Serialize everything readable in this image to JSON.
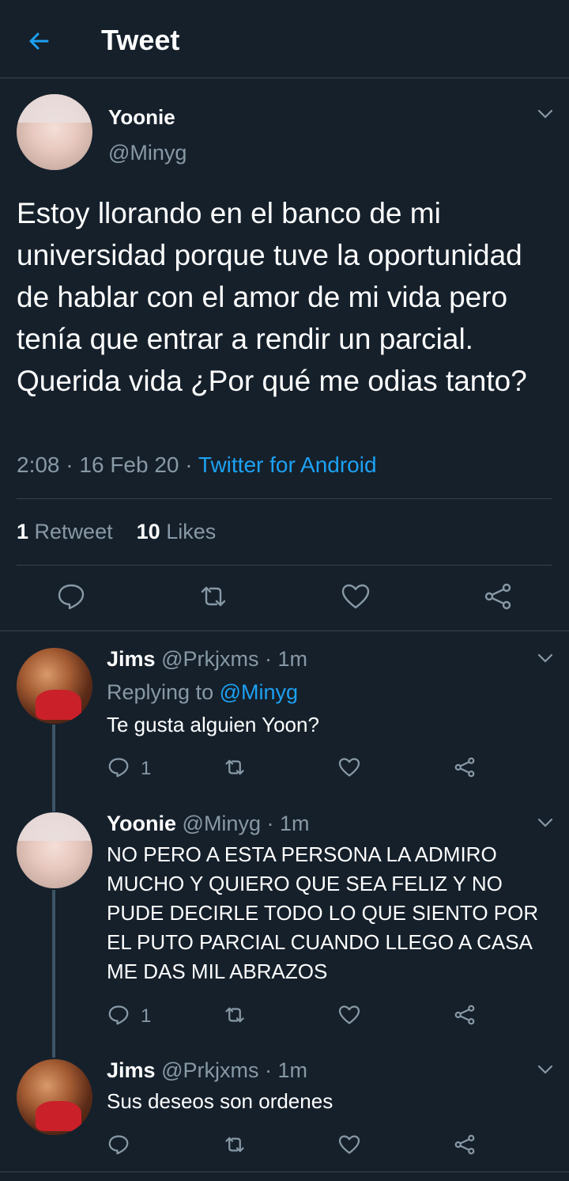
{
  "header": {
    "title": "Tweet"
  },
  "main_tweet": {
    "name": "Yoonie",
    "handle": "@Minyg",
    "text": "Estoy llorando en el banco de mi universidad porque tuve la oportunidad de hablar con el amor de mi vida pero tenía que entrar a rendir un parcial. Querida vida ¿Por qué me odias tanto?",
    "time": "2:08",
    "date": "16 Feb 20",
    "source": "Twitter for Android",
    "retweets": "1",
    "retweets_label": "Retweet",
    "likes": "10",
    "likes_label": "Likes"
  },
  "replies": [
    {
      "name": "Jims",
      "handle": "@Prkjxms",
      "time": "1m",
      "replying_label": "Replying to",
      "replying_to": "@Minyg",
      "text": "Te gusta alguien Yoon?",
      "reply_count": "1"
    },
    {
      "name": "Yoonie",
      "handle": "@Minyg",
      "time": "1m",
      "text": "NO PERO A ESTA PERSONA LA ADMIRO MUCHO Y QUIERO QUE SEA FELIZ Y NO PUDE DECIRLE TODO LO QUE SIENTO POR EL PUTO PARCIAL CUANDO LLEGO A CASA ME DAS MIL ABRAZOS",
      "reply_count": "1"
    },
    {
      "name": "Jims",
      "handle": "@Prkjxms",
      "time": "1m",
      "text": "Sus deseos son ordenes",
      "reply_count": ""
    }
  ],
  "separator": "·",
  "colors": {
    "background": "#15202b",
    "accent": "#1da1f2",
    "muted": "#8899a6",
    "border": "#38444d"
  }
}
